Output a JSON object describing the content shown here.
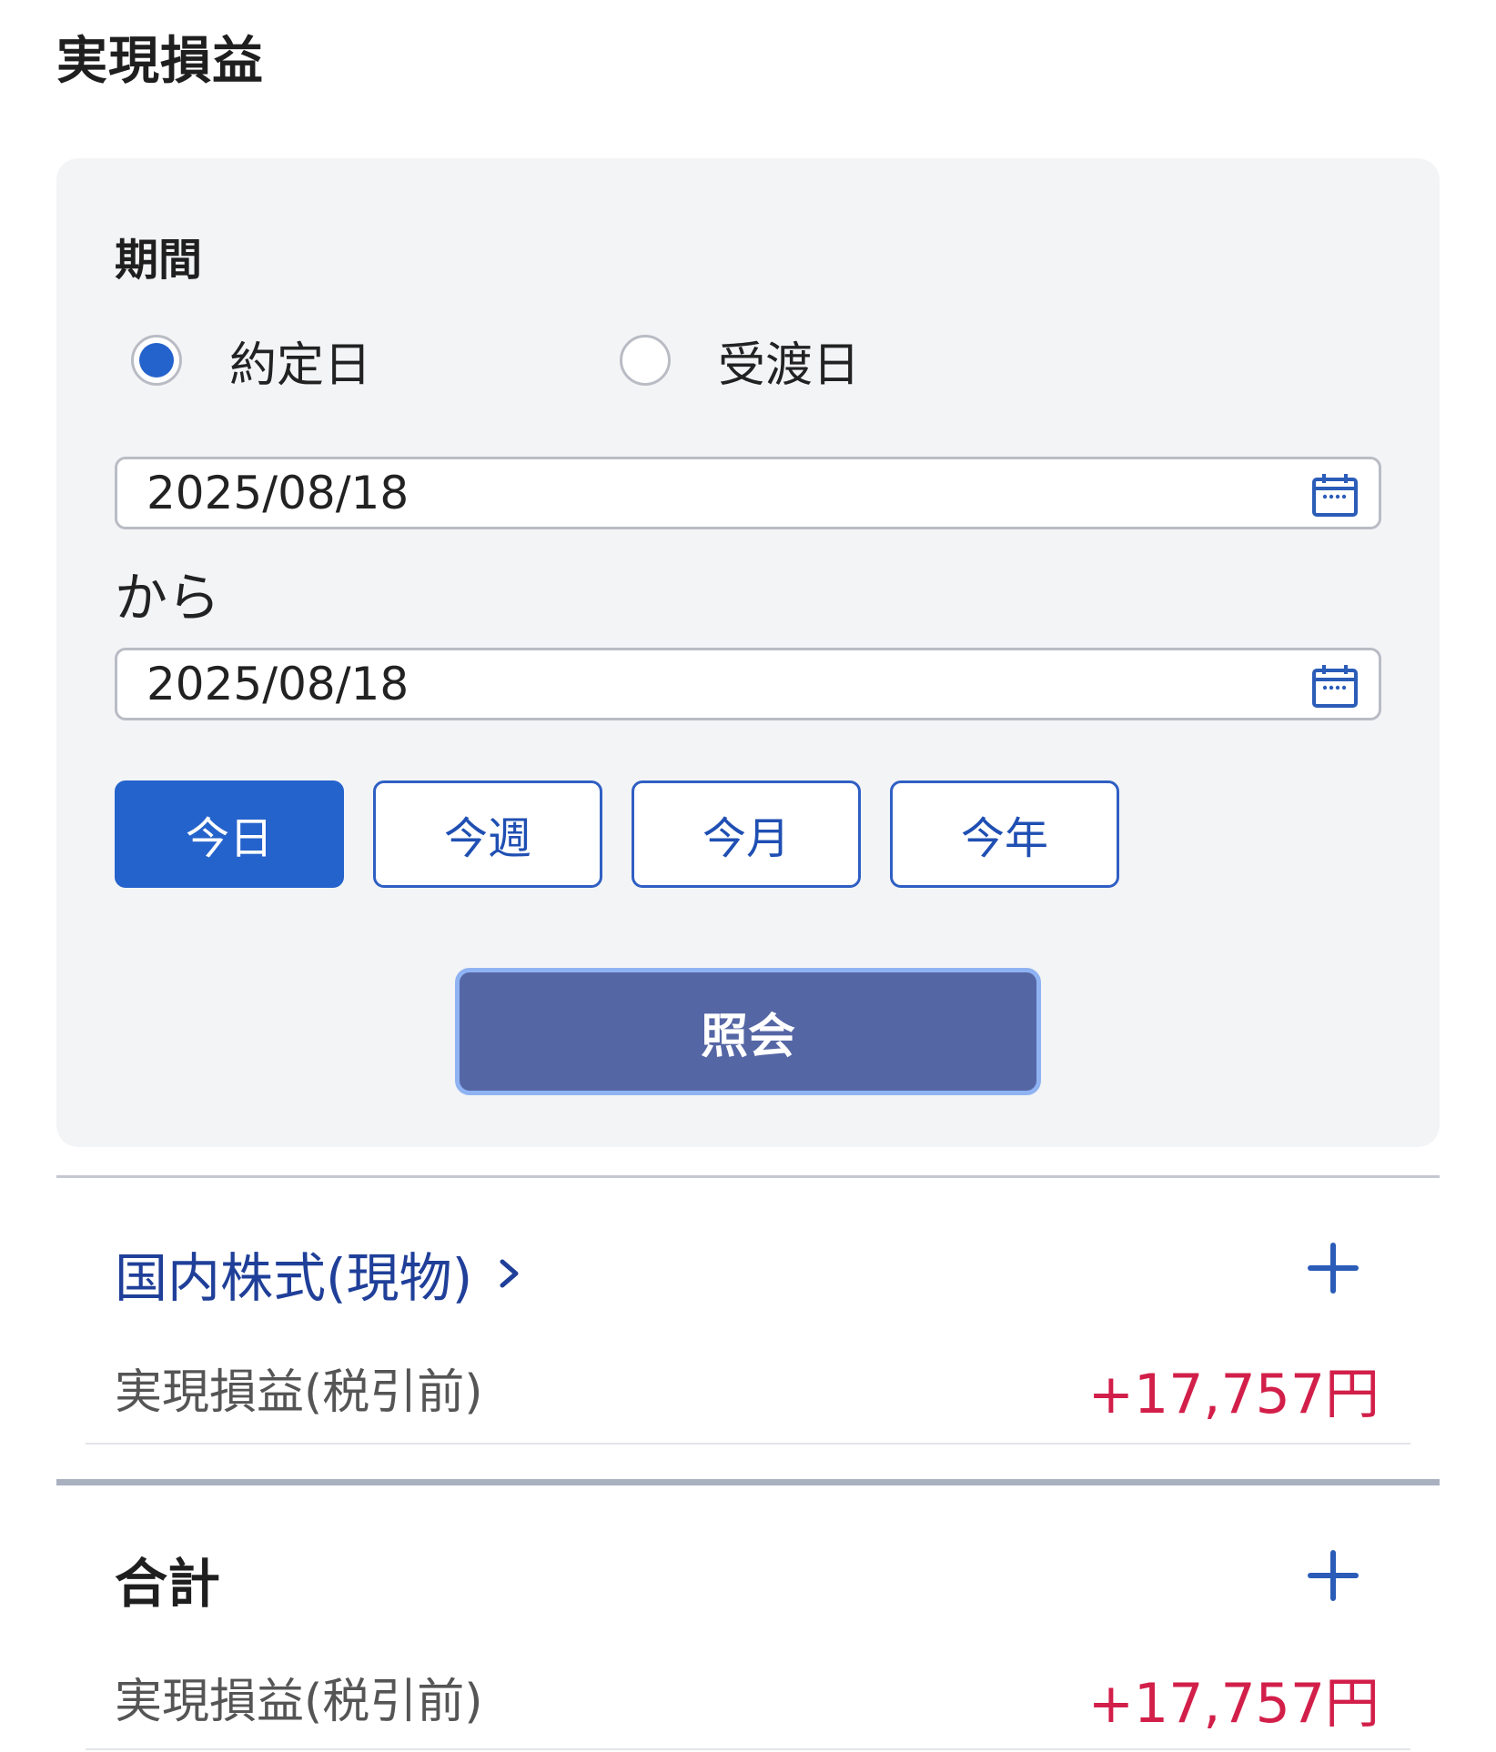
{
  "page": {
    "title": "実現損益"
  },
  "filter": {
    "period_label": "期間",
    "radio_options": [
      {
        "label": "約定日",
        "selected": true
      },
      {
        "label": "受渡日",
        "selected": false
      }
    ],
    "date_from": "2025/08/18",
    "separator": "から",
    "date_to": "2025/08/18",
    "calendar_icon": "calendar-icon",
    "quick_buttons": [
      {
        "label": "今日",
        "active": true
      },
      {
        "label": "今週",
        "active": false
      },
      {
        "label": "今月",
        "active": false
      },
      {
        "label": "今年",
        "active": false
      }
    ],
    "query_button": "照会"
  },
  "sections": [
    {
      "title": "国内株式(現物)",
      "title_icon": "chevron-right-icon",
      "expand_icon": "plus-icon",
      "row_label": "実現損益(税引前)",
      "row_value": "+17,757円"
    }
  ],
  "total": {
    "title": "合計",
    "expand_icon": "plus-icon",
    "row_label": "実現損益(税引前)",
    "row_value": "+17,757円"
  },
  "colors": {
    "accent": "#2563cc",
    "link": "#1f3f99",
    "query_button": "#5566a5",
    "positive_value": "#d21f4a",
    "panel_bg": "#f3f4f6"
  }
}
